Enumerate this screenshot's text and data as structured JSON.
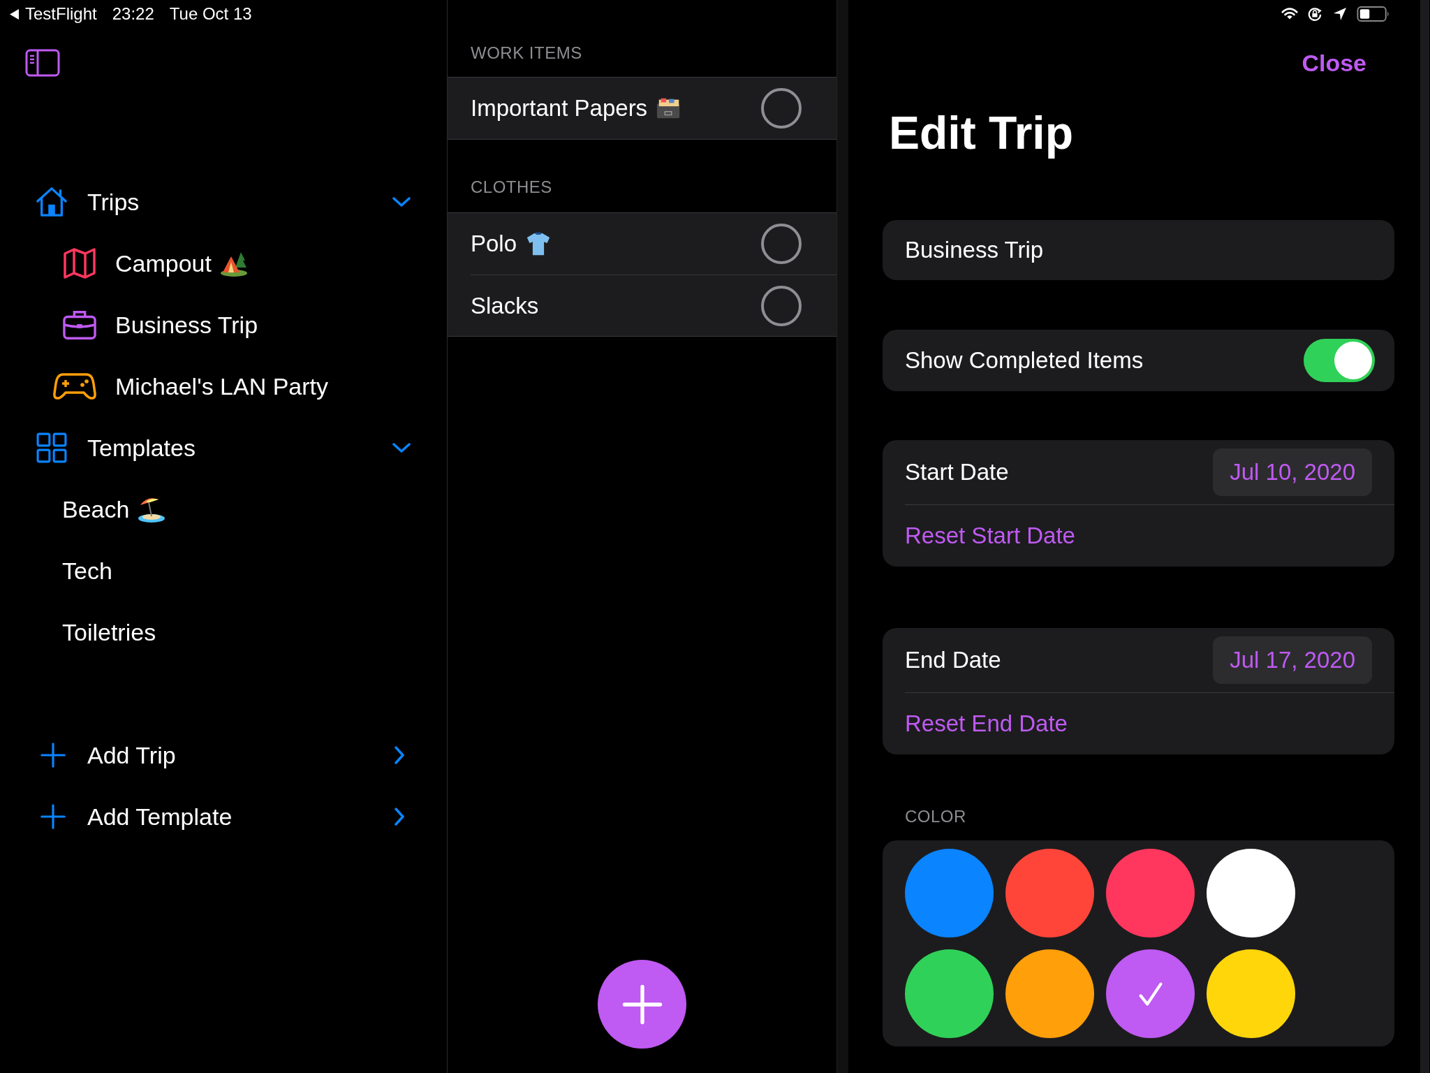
{
  "status_bar": {
    "back_label": "TestFlight",
    "time": "23:22",
    "date": "Tue Oct 13"
  },
  "sidebar": {
    "sections": [
      {
        "label": "Trips",
        "kind": "house",
        "expanded": true,
        "children": [
          {
            "label": "Campout",
            "kind": "map",
            "color": "#ff375f",
            "badge": {
              "kind": "tent"
            }
          },
          {
            "label": "Business Trip",
            "kind": "briefcase",
            "color": "#bf5af2"
          },
          {
            "label": "Michael's LAN Party",
            "kind": "gamepad",
            "color": "#ff9f0a"
          }
        ]
      },
      {
        "label": "Templates",
        "kind": "grid",
        "expanded": true,
        "children": [
          {
            "label": "Beach",
            "badge": {
              "kind": "beach"
            }
          },
          {
            "label": "Tech"
          },
          {
            "label": "Toiletries"
          }
        ]
      }
    ],
    "actions": [
      {
        "label": "Add Trip"
      },
      {
        "label": "Add Template"
      }
    ]
  },
  "list": {
    "sections": [
      {
        "header": "WORK ITEMS",
        "items": [
          {
            "label": "Important Papers",
            "badge": {
              "kind": "file-box"
            },
            "checked": false
          }
        ]
      },
      {
        "header": "CLOTHES",
        "items": [
          {
            "label": "Polo",
            "badge": {
              "kind": "shirt"
            },
            "checked": false
          },
          {
            "label": "Slacks",
            "checked": false
          }
        ]
      }
    ]
  },
  "editor": {
    "close": "Close",
    "title": "Edit Trip",
    "name_field": {
      "value": "Business Trip"
    },
    "show_completed": {
      "label": "Show Completed Items",
      "on": true
    },
    "dates": [
      {
        "label": "Start Date",
        "value": "Jul 10, 2020",
        "reset": "Reset Start Date"
      },
      {
        "label": "End Date",
        "value": "Jul 17, 2020",
        "reset": "Reset End Date"
      }
    ],
    "color_header": "COLOR",
    "swatches": [
      {
        "color": "#0a84ff",
        "selected": false
      },
      {
        "color": "#ff453a",
        "selected": false
      },
      {
        "color": "#ff375f",
        "selected": false
      },
      {
        "color": "#ffffff",
        "selected": false
      },
      {
        "color": "#30d158",
        "selected": false
      },
      {
        "color": "#ff9f0a",
        "selected": false
      },
      {
        "color": "#bf5af2",
        "selected": true
      },
      {
        "color": "#ffd60a",
        "selected": false
      }
    ]
  }
}
